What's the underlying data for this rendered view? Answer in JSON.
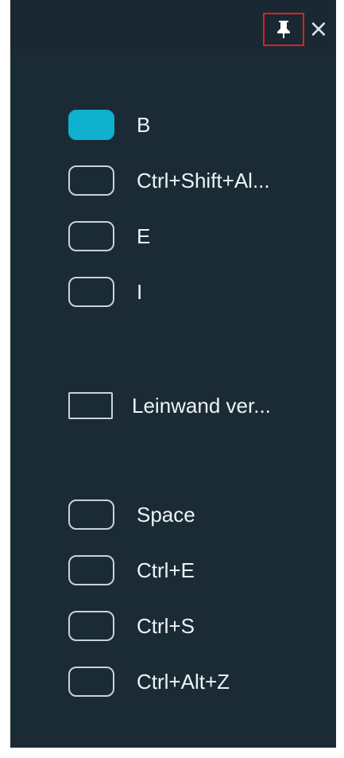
{
  "header": {
    "pin_icon": "pin-icon",
    "close_icon": "close-icon",
    "close_glyph": "×"
  },
  "shortcuts": [
    {
      "label": "B",
      "active": true
    },
    {
      "label": "Ctrl+Shift+Al...",
      "active": false
    },
    {
      "label": "E",
      "active": false
    },
    {
      "label": "I",
      "active": false
    },
    {
      "label": "Leinwand ver...",
      "active": false
    },
    {
      "label": "Space",
      "active": false
    },
    {
      "label": "Ctrl+E",
      "active": false
    },
    {
      "label": "Ctrl+S",
      "active": false
    },
    {
      "label": "Ctrl+Alt+Z",
      "active": false
    }
  ],
  "colors": {
    "panel_bg": "#1b2b36",
    "accent": "#0fb1cf",
    "highlight_border": "#e02020",
    "text": "#eef3f6"
  }
}
